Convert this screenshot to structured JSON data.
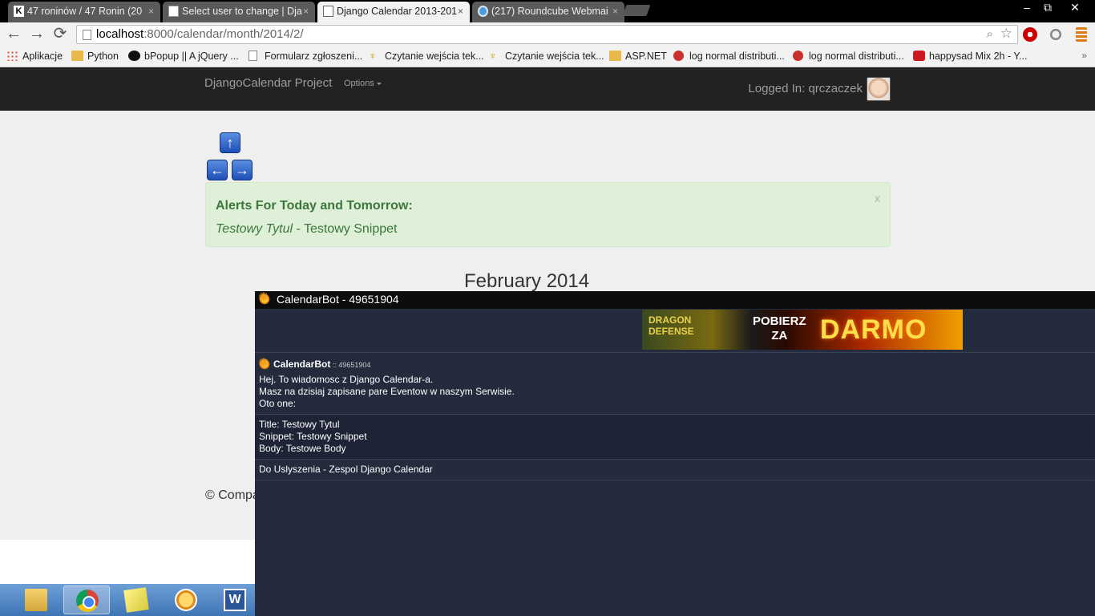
{
  "browser": {
    "tabs": [
      {
        "label": "47 roninów / 47 Ronin (20",
        "active": false
      },
      {
        "label": "Select user to change | Dja",
        "active": false
      },
      {
        "label": "Django Calendar 2013-201",
        "active": true
      },
      {
        "label": "(217) Roundcube Webmai",
        "active": false
      }
    ],
    "tab_close": "×",
    "window_controls": {
      "minimize": "–",
      "restore": "⧉",
      "close": "✕"
    },
    "nav": {
      "back": "←",
      "forward": "→",
      "reload": "⟳"
    },
    "url": {
      "host": "localhost",
      "rest": ":8000/calendar/month/2014/2/"
    },
    "bookmarks": [
      {
        "label": "Aplikacje",
        "icon": "apps-icon"
      },
      {
        "label": "Python",
        "icon": "folder-icon"
      },
      {
        "label": "bPopup || A jQuery ...",
        "icon": "bo-icon"
      },
      {
        "label": "Formularz zgłoszeni...",
        "icon": "doc-icon"
      },
      {
        "label": "Czytanie wejścia tek...",
        "icon": "torch-icon"
      },
      {
        "label": "Czytanie wejścia tek...",
        "icon": "torch-icon"
      },
      {
        "label": "ASP.NET",
        "icon": "folder-icon"
      },
      {
        "label": "log normal distributi...",
        "icon": "red-icon"
      },
      {
        "label": "log normal distributi...",
        "icon": "red-icon"
      },
      {
        "label": "happysad Mix 2h - Y...",
        "icon": "youtube-icon"
      }
    ],
    "bookmarks_more": "»"
  },
  "site": {
    "brand": "DjangoCalendar Project",
    "options": "Options",
    "logged_in": "Logged In: qrczaczek",
    "nav_arrows": {
      "up": "↑",
      "left": "←",
      "right": "→"
    },
    "alert": {
      "title": "Alerts For Today and Tomorrow:",
      "item_title": "Testowy Tytul",
      "item_rest": " - Testowy Snippet",
      "close": "x"
    },
    "month_title": "February 2014",
    "footer": "© Compa"
  },
  "taskbar": {
    "apps": [
      "explorer",
      "chrome",
      "sticky-notes",
      "outlook",
      "word"
    ],
    "word_letter": "W"
  },
  "popup": {
    "title": "CalendarBot - 49651904",
    "ad": {
      "line1": "DRAGON",
      "line2": "DEFENSE",
      "pobierz1": "POBIERZ",
      "pobierz2": "ZA",
      "darmo": "DARMO"
    },
    "sender_name": "CalendarBot",
    "sender_uin": " :: 49651904",
    "message1": [
      "Hej. To wiadomosc z Django Calendar-a.",
      "Masz na dzisiaj zapisane pare Eventow w naszym Serwisie.",
      "Oto one:"
    ],
    "message2": [
      "Title: Testowy Tytul",
      "Snippet: Testowy Snippet",
      "Body: Testowe Body"
    ],
    "message3": "Do Uslyszenia - Zespol Django Calendar"
  },
  "colors": {
    "navbar": "#222222",
    "alert_bg": "#dff0d8",
    "alert_text": "#3c763d",
    "popup_bg": "#232b3d"
  }
}
